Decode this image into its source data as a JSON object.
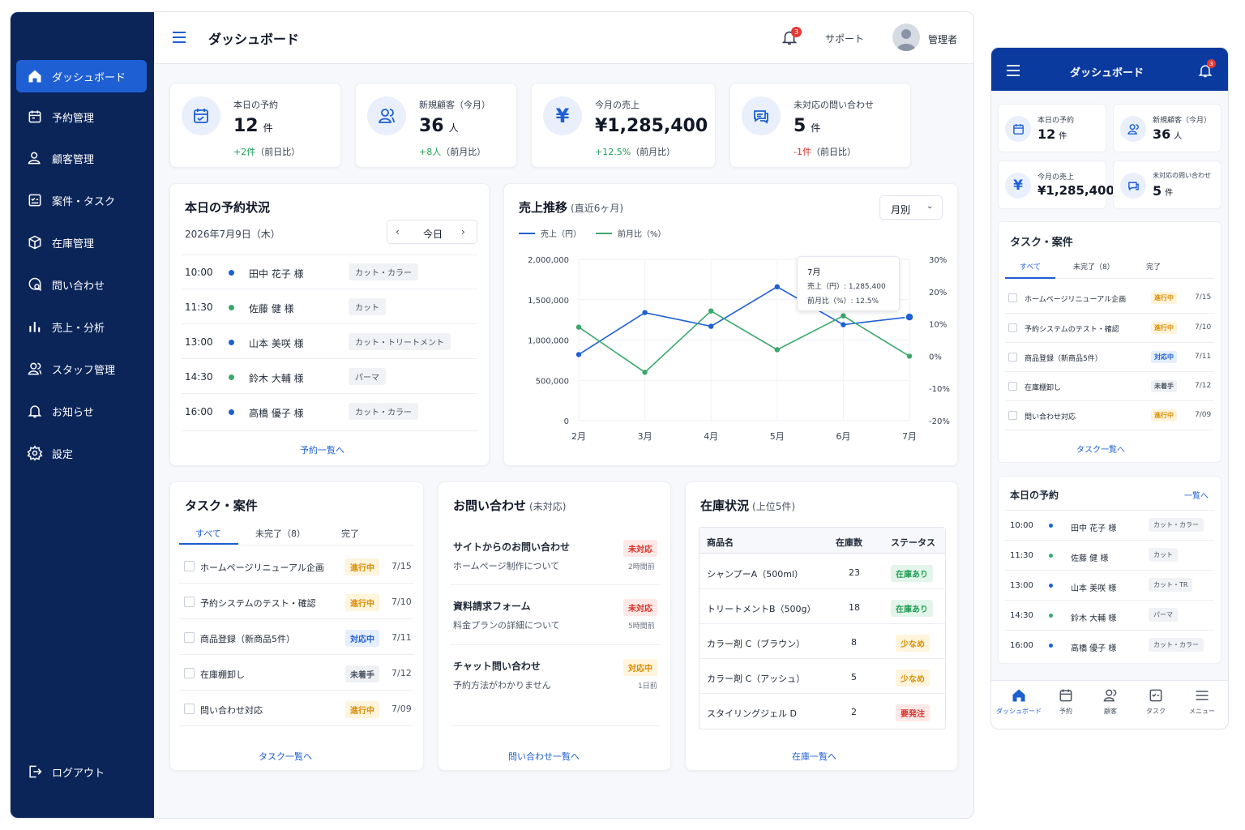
{
  "app": {
    "title": "ダッシュボード"
  },
  "colors": {
    "sidebar": "#0b2559",
    "accent": "#1e5fd4",
    "sales_line": "#1e5fd4",
    "ratio_line": "#3aa86b"
  },
  "sidebar": {
    "items": [
      {
        "label": "ダッシュボード",
        "icon": "home-icon",
        "active": true
      },
      {
        "label": "予約管理",
        "icon": "calendar-icon"
      },
      {
        "label": "顧客管理",
        "icon": "user-icon"
      },
      {
        "label": "案件・タスク",
        "icon": "checklist-icon"
      },
      {
        "label": "在庫管理",
        "icon": "box-icon"
      },
      {
        "label": "問い合わせ",
        "icon": "chat-search-icon"
      },
      {
        "label": "売上・分析",
        "icon": "bar-chart-icon"
      },
      {
        "label": "スタッフ管理",
        "icon": "users-icon"
      },
      {
        "label": "お知らせ",
        "icon": "bell-icon"
      },
      {
        "label": "設定",
        "icon": "gear-icon"
      }
    ],
    "logout": "ログアウト"
  },
  "header": {
    "title": "ダッシュボード",
    "notifications": "3",
    "support": "サポート",
    "user": "管理者"
  },
  "stats": [
    {
      "label": "本日の予約",
      "value": "12",
      "unit": "件",
      "delta": "+2件",
      "note": "（前日比）",
      "trend": "up",
      "icon": "calendar-icon"
    },
    {
      "label": "新規顧客（今月）",
      "value": "36",
      "unit": "人",
      "delta": "+8人",
      "note": "（前月比）",
      "trend": "up",
      "icon": "users-icon"
    },
    {
      "label": "今月の売上",
      "value": "¥1,285,400",
      "unit": "",
      "delta": "+12.5%",
      "note": "（前月比）",
      "trend": "up",
      "icon": "yen-icon"
    },
    {
      "label": "未対応の問い合わせ",
      "value": "5",
      "unit": "件",
      "delta": "-1件",
      "note": "（前日比）",
      "trend": "down",
      "icon": "chat-icon"
    }
  ],
  "reservations": {
    "title": "本日の予約状況",
    "date": "2026年7月9日（木）",
    "today_btn": "今日",
    "items": [
      {
        "time": "10:00",
        "name": "田中 花子 様",
        "menu": "カット・カラー",
        "dot": "blue",
        "menu_short": "カット・カラー"
      },
      {
        "time": "11:30",
        "name": "佐藤 健 様",
        "menu": "カット",
        "dot": "green",
        "menu_short": "カット"
      },
      {
        "time": "13:00",
        "name": "山本 美咲 様",
        "menu": "カット・トリートメント",
        "dot": "blue",
        "menu_short": "カット・TR"
      },
      {
        "time": "14:30",
        "name": "鈴木 大輔 様",
        "menu": "パーマ",
        "dot": "green",
        "menu_short": "パーマ"
      },
      {
        "time": "16:00",
        "name": "高橋 優子 様",
        "menu": "カット・カラー",
        "dot": "blue",
        "menu_short": "カット・カラー"
      }
    ],
    "link": "予約一覧へ"
  },
  "sales_chart": {
    "title": "売上推移",
    "subtitle": "(直近6ヶ月)",
    "period": "月別",
    "tooltip": {
      "month": "7月",
      "sales": "売上（円）: 1,285,400",
      "ratio": "前月比（%）: 12.5%"
    }
  },
  "chart_data": {
    "type": "line",
    "title": "売上推移",
    "subtitle": "(直近6ヶ月)",
    "categories": [
      "2月",
      "3月",
      "4月",
      "5月",
      "6月",
      "7月"
    ],
    "series": [
      {
        "name": "売上（円）",
        "axis": "left",
        "values": [
          820000,
          1340000,
          1170000,
          1660000,
          1190000,
          1285400
        ]
      },
      {
        "name": "前月比（%）",
        "axis": "right",
        "values": [
          9,
          -5,
          14,
          2,
          12.5,
          0
        ]
      }
    ],
    "ylim_left": [
      0,
      2000000
    ],
    "yticks_left": [
      "0",
      "500,000",
      "1,000,000",
      "1,500,000",
      "2,000,000"
    ],
    "ylim_right": [
      -20,
      30
    ],
    "yticks_right": [
      "-20%",
      "-10%",
      "0%",
      "10%",
      "20%",
      "30%"
    ],
    "grid": true,
    "legend_position": "top-left"
  },
  "tasks": {
    "title": "タスク・案件",
    "tabs": [
      "すべて",
      "未完了（8）",
      "完了"
    ],
    "items": [
      {
        "name": "ホームページリニューアル企画",
        "status": "進行中",
        "kind": "prog",
        "date": "7/15"
      },
      {
        "name": "予約システムのテスト・確認",
        "status": "進行中",
        "kind": "prog",
        "date": "7/10"
      },
      {
        "name": "商品登録（新商品5件）",
        "status": "対応中",
        "kind": "resp",
        "date": "7/11"
      },
      {
        "name": "在庫棚卸し",
        "status": "未着手",
        "kind": "none",
        "date": "7/12"
      },
      {
        "name": "問い合わせ対応",
        "status": "進行中",
        "kind": "prog",
        "date": "7/09"
      }
    ],
    "link": "タスク一覧へ"
  },
  "inquiries": {
    "title": "お問い合わせ",
    "subtitle": "(未対応)",
    "items": [
      {
        "title": "サイトからのお問い合わせ",
        "body": "ホームページ制作について",
        "status": "未対応",
        "kind": "new",
        "time": "2時間前"
      },
      {
        "title": "資料請求フォーム",
        "body": "料金プランの詳細について",
        "status": "未対応",
        "kind": "new",
        "time": "5時間前"
      },
      {
        "title": "チャット問い合わせ",
        "body": "予約方法がわかりません",
        "status": "対応中",
        "kind": "prog",
        "time": "1日前"
      }
    ],
    "link": "問い合わせ一覧へ"
  },
  "inventory": {
    "title": "在庫状況",
    "subtitle": "(上位5件)",
    "columns": [
      "商品名",
      "在庫数",
      "ステータス"
    ],
    "rows": [
      {
        "name": "シャンプーA（500ml）",
        "qty": "23",
        "status": "在庫あり",
        "kind": "ok"
      },
      {
        "name": "トリートメントB（500g）",
        "qty": "18",
        "status": "在庫あり",
        "kind": "ok"
      },
      {
        "name": "カラー剤 C（ブラウン）",
        "qty": "8",
        "status": "少なめ",
        "kind": "low"
      },
      {
        "name": "カラー剤 C（アッシュ）",
        "qty": "5",
        "status": "少なめ",
        "kind": "low"
      },
      {
        "name": "スタイリングジェル D",
        "qty": "2",
        "status": "要発注",
        "kind": "order"
      }
    ],
    "link": "在庫一覧へ"
  },
  "mobile": {
    "title": "ダッシュボード",
    "notifications": "3",
    "reservations_title": "本日の予約",
    "reservations_link": "一覧へ",
    "nav": [
      "ダッシュボード",
      "予約",
      "顧客",
      "タスク",
      "メニュー"
    ]
  }
}
